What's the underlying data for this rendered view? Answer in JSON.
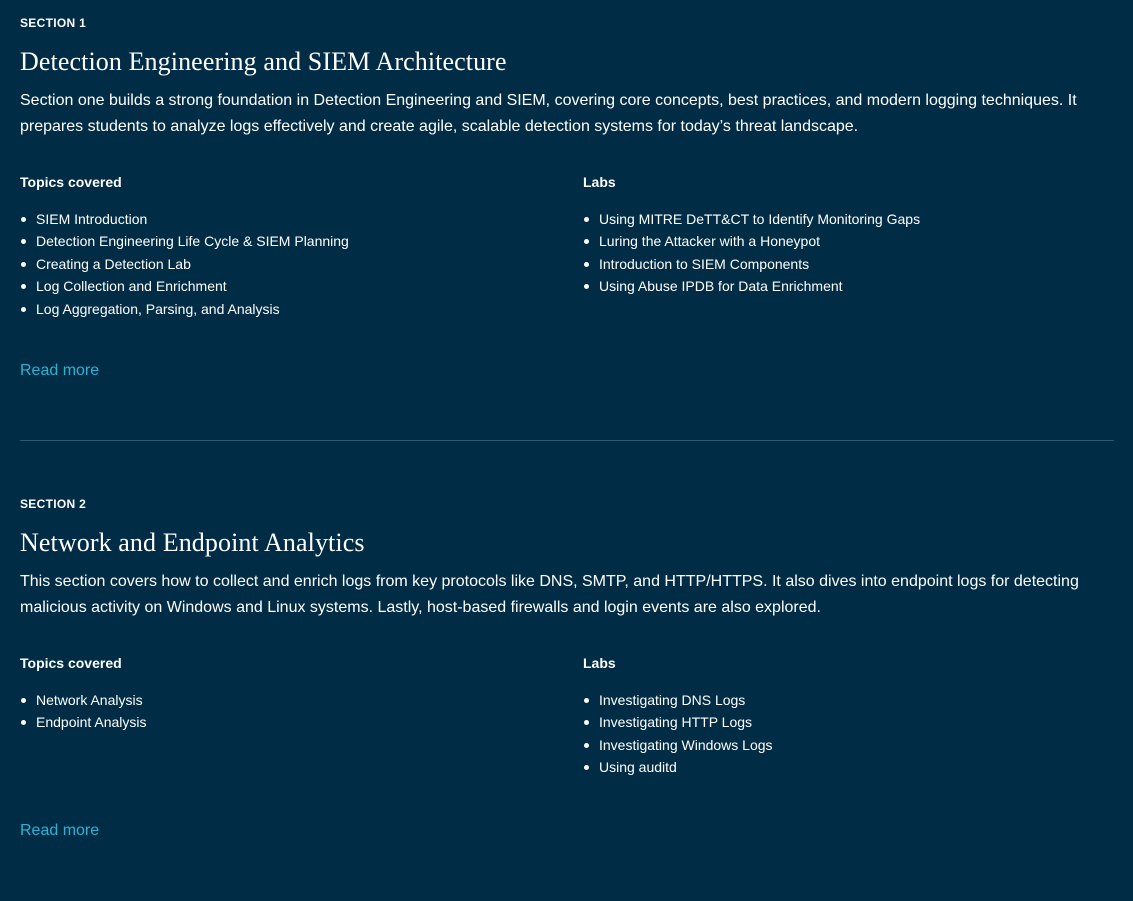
{
  "sections": [
    {
      "eyebrow": "SECTION 1",
      "title": "Detection Engineering and SIEM Architecture",
      "description": "Section one builds a strong foundation in Detection Engineering and SIEM, covering core concepts, best practices, and modern logging techniques. It prepares students to analyze logs effectively and create agile, scalable detection systems for today’s threat landscape.",
      "topics_heading": "Topics covered",
      "topics": [
        "SIEM Introduction",
        "Detection Engineering Life Cycle & SIEM Planning",
        "Creating a Detection Lab",
        "Log Collection and Enrichment",
        "Log Aggregation, Parsing, and Analysis"
      ],
      "labs_heading": "Labs",
      "labs": [
        "Using MITRE DeTT&CT to Identify Monitoring Gaps",
        "Luring the Attacker with a Honeypot",
        "Introduction to SIEM Components",
        "Using Abuse IPDB for Data Enrichment"
      ],
      "read_more": "Read more"
    },
    {
      "eyebrow": "SECTION 2",
      "title": "Network and Endpoint Analytics",
      "description": "This section covers how to collect and enrich logs from key protocols like DNS, SMTP, and HTTP/HTTPS. It also dives into endpoint logs for detecting malicious activity on Windows and Linux systems. Lastly, host-based firewalls and login events are also explored.",
      "topics_heading": "Topics covered",
      "topics": [
        "Network Analysis",
        "Endpoint Analysis"
      ],
      "labs_heading": "Labs",
      "labs": [
        "Investigating DNS Logs",
        "Investigating HTTP Logs",
        "Investigating Windows Logs",
        "Using auditd"
      ],
      "read_more": "Read more"
    }
  ],
  "colors": {
    "background": "#012c45",
    "text": "#ffffff",
    "link": "#2cb3d3",
    "divider": "#2c5a6e"
  }
}
